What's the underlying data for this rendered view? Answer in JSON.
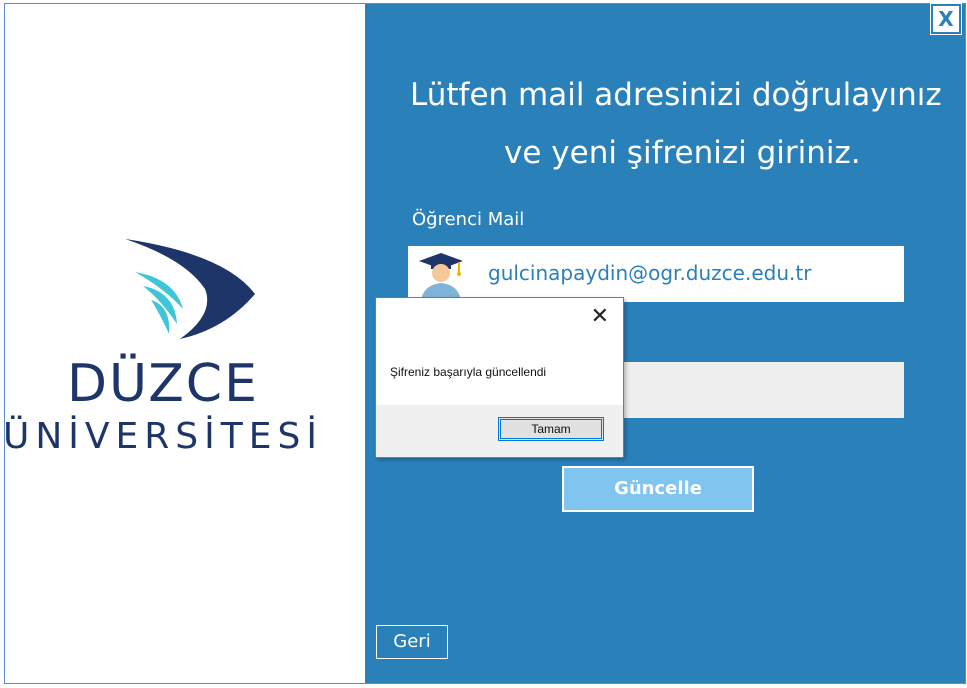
{
  "brand": {
    "name": "DÜZCE",
    "subtitle": "ÜNİVERSİTESİ"
  },
  "header": {
    "close_label": "X",
    "line1": "Lütfen mail adresinizi doğrulayınız",
    "line2": "ve yeni şifrenizi giriniz."
  },
  "form": {
    "mail_label": "Öğrenci Mail",
    "mail_value": "gulcinapaydin@ogr.duzce.edu.tr",
    "password_value": "",
    "update_button": "Güncelle",
    "back_button": "Geri"
  },
  "dialog": {
    "message": "Şifreniz başarıyla güncellendi",
    "ok_button": "Tamam",
    "close_icon": "close-icon"
  },
  "colors": {
    "panel_blue": "#2a80b9",
    "brand_navy": "#1d3568",
    "brand_cyan": "#3ec6d8",
    "button_light": "#7fc5f0"
  }
}
